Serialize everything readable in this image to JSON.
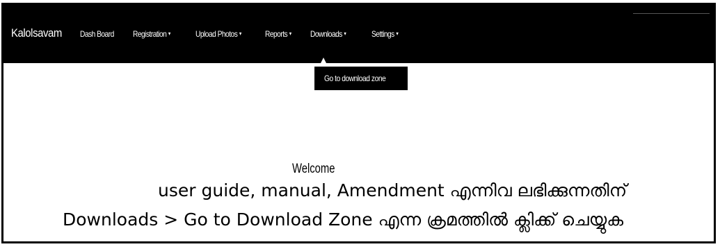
{
  "navbar": {
    "brand": "Kalolsavam",
    "items": [
      {
        "label": "Dash Board",
        "has_caret": false
      },
      {
        "label": "Registration",
        "has_caret": true
      },
      {
        "label": "Upload Photos",
        "has_caret": true
      },
      {
        "label": "Reports",
        "has_caret": true
      },
      {
        "label": "Downloads",
        "has_caret": true
      },
      {
        "label": "Settings",
        "has_caret": true
      }
    ],
    "caret_glyph": "▾"
  },
  "downloads_dropdown": {
    "items": [
      "Go to download zone"
    ]
  },
  "main": {
    "welcome": "Welcome",
    "line1": "user guide, manual, Amendment എന്നിവ ലഭിക്കുന്നതിന്",
    "line2": "Downloads > Go to Download Zone എന്ന ക്രമത്തിൽ ക്ലിക്ക് ചെയ്യുക"
  },
  "colors": {
    "navbar_bg": "#000000",
    "nav_text": "#ffffff",
    "page_bg": "#ffffff",
    "body_text": "#000000"
  }
}
